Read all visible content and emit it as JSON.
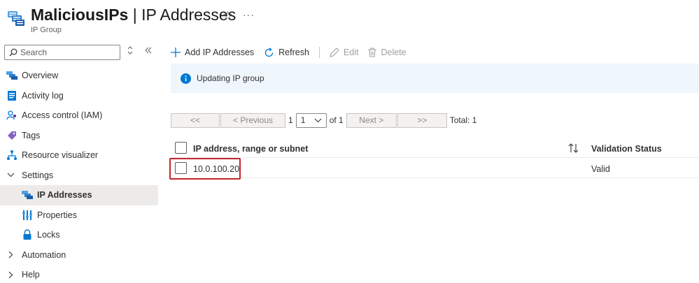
{
  "header": {
    "resource_name": "MaliciousIPs",
    "separator": " | ",
    "page_name": "IP Addresses",
    "subtitle": "IP Group",
    "icon": "ip-group-icon",
    "favorite_icon": "star-icon",
    "more_label": "···"
  },
  "sidebar": {
    "search_placeholder": "Search",
    "items": [
      {
        "label": "Overview",
        "icon": "ip-group-icon"
      },
      {
        "label": "Activity log",
        "icon": "activity-log-icon"
      },
      {
        "label": "Access control (IAM)",
        "icon": "people-icon"
      },
      {
        "label": "Tags",
        "icon": "tag-icon"
      },
      {
        "label": "Resource visualizer",
        "icon": "visualizer-icon"
      },
      {
        "label": "Settings",
        "icon": "chevron-down-icon"
      },
      {
        "label": "IP Addresses",
        "icon": "ip-group-icon"
      },
      {
        "label": "Properties",
        "icon": "properties-icon"
      },
      {
        "label": "Locks",
        "icon": "lock-icon"
      },
      {
        "label": "Automation",
        "icon": "chevron-right-icon"
      },
      {
        "label": "Help",
        "icon": "chevron-right-icon"
      }
    ]
  },
  "toolbar": {
    "add_label": "Add IP Addresses",
    "refresh_label": "Refresh",
    "edit_label": "Edit",
    "delete_label": "Delete"
  },
  "banner": {
    "message": "Updating IP group"
  },
  "pager": {
    "first_label": "<<",
    "prev_label": "< Previous",
    "current_page": "1",
    "page_select_value": "1",
    "of_label": "of 1",
    "next_label": "Next >",
    "last_label": ">>",
    "total_label": "Total: 1"
  },
  "grid": {
    "columns": [
      "IP address, range or subnet",
      "Validation Status"
    ],
    "rows": [
      {
        "ip": "10.0.100.20",
        "status": "Valid"
      }
    ]
  },
  "colors": {
    "accent": "#0078d4",
    "highlight_border": "#c4262e",
    "banner_bg": "#eff6fc",
    "active_nav_bg": "#edebe9"
  }
}
